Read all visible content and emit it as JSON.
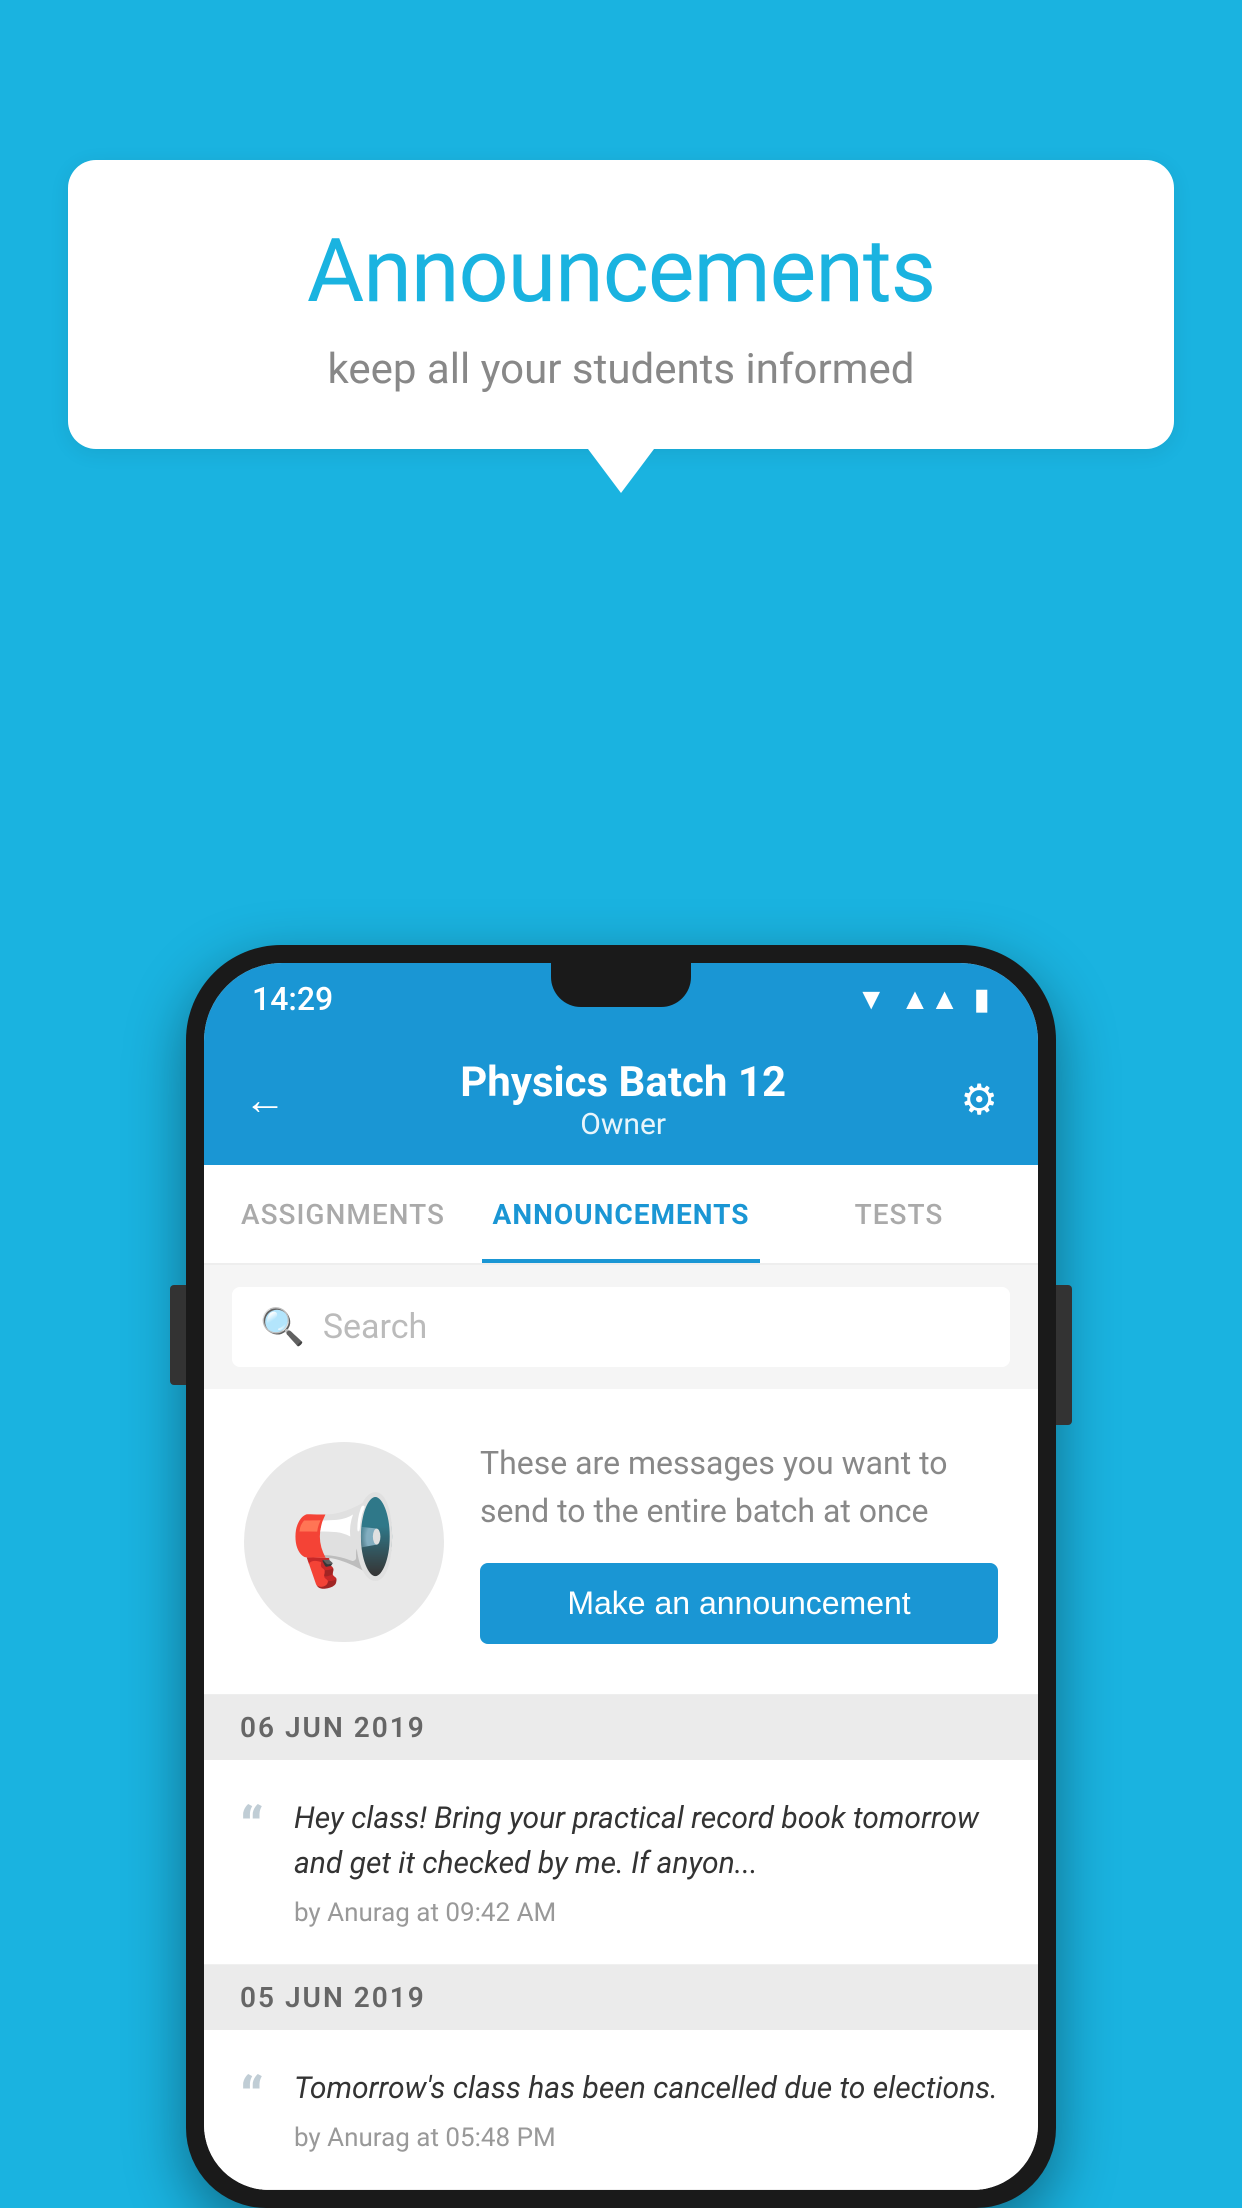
{
  "background_color": "#1ab3e0",
  "speech_bubble": {
    "title": "Announcements",
    "subtitle": "keep all your students informed"
  },
  "phone": {
    "status_bar": {
      "time": "14:29",
      "wifi_symbol": "▼",
      "signal_symbol": "▲",
      "battery_symbol": "▮"
    },
    "header": {
      "title": "Physics Batch 12",
      "subtitle": "Owner",
      "back_label": "←",
      "settings_label": "⚙"
    },
    "tabs": [
      {
        "label": "ASSIGNMENTS",
        "active": false
      },
      {
        "label": "ANNOUNCEMENTS",
        "active": true
      },
      {
        "label": "TESTS",
        "active": false
      }
    ],
    "search": {
      "placeholder": "Search"
    },
    "empty_state": {
      "description_text": "These are messages you want to send to the entire batch at once",
      "cta_label": "Make an announcement"
    },
    "announcements": [
      {
        "date": "06  JUN  2019",
        "text": "Hey class! Bring your practical record book tomorrow and get it checked by me. If anyon...",
        "meta": "by Anurag at 09:42 AM"
      },
      {
        "date": "05  JUN  2019",
        "text": "Tomorrow's class has been cancelled due to elections.",
        "meta": "by Anurag at 05:48 PM"
      }
    ]
  }
}
